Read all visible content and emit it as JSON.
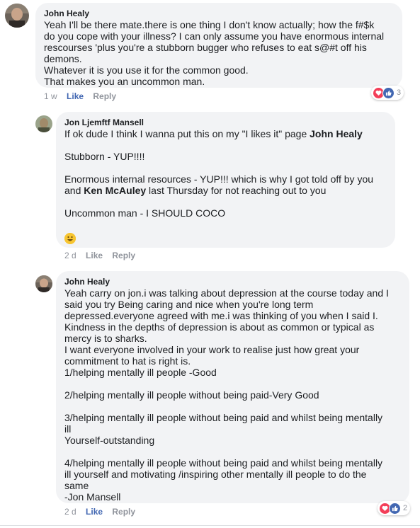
{
  "comments": [
    {
      "author": "John Healy",
      "lines": [
        "Yeah I'll be there mate.there is one thing I don't know actually; how the f#$k",
        "do you cope with your illness? I can only assume you have enormous internal",
        "rescourses 'plus you're a stubborn bugger who refuses to eat s@#t off his",
        "demons.",
        "Whatever it is you use it for the common good.",
        "That makes you an uncommon man."
      ],
      "time": "1 w",
      "like": "Like",
      "reply": "Reply",
      "reaction_count": "3"
    },
    {
      "author": "Jon Ljemftf Mansell",
      "line1_text": "If ok dude I think I wanna put this on my \"I likes it\" page ",
      "line1_mention": "John Healy",
      "line2": "Stubborn - YUP!!!!",
      "line3": "Enormous internal resources - YUP!!! which is why I got told off by you",
      "line4_pre": "and ",
      "line4_mention": "Ken McAuley",
      "line4_post": " last Thursday for not reaching out to you",
      "line5": "Uncommon man - I SHOULD COCO",
      "emoji": "smiley-emoji",
      "time": "2 d",
      "like": "Like",
      "reply": "Reply"
    },
    {
      "author": "John Healy",
      "lines": [
        "Yeah carry on jon.i was talking about depression at the course today and I",
        "said you try Being caring and nice when you're long term",
        "depressed.everyone agreed with me.i was thinking of you when I said I.",
        "Kindness in the depths of depression is about as common or typical as",
        "mercy is to sharks.",
        "I want everyone involved in your work to realise just how great your",
        "commitment to hat is right is.",
        "1/helping mentally ill people -Good",
        "",
        "2/helping mentally ill people without being paid-Very Good",
        "",
        "3/helping mentally ill people without being paid and whilst being mentally",
        "ill",
        "Yourself-outstanding",
        "",
        "4/helping mentally ill people without being paid and whilst being mentally",
        "ill yourself and motivating /inspiring other mentally ill people to do the",
        "same",
        "-Jon Mansell"
      ],
      "time": "2 d",
      "like": "Like",
      "reply": "Reply",
      "reaction_count": "2"
    }
  ],
  "colors": {
    "link": "#4267b2",
    "bubble": "#f2f3f5",
    "heart": "#f33e58"
  }
}
